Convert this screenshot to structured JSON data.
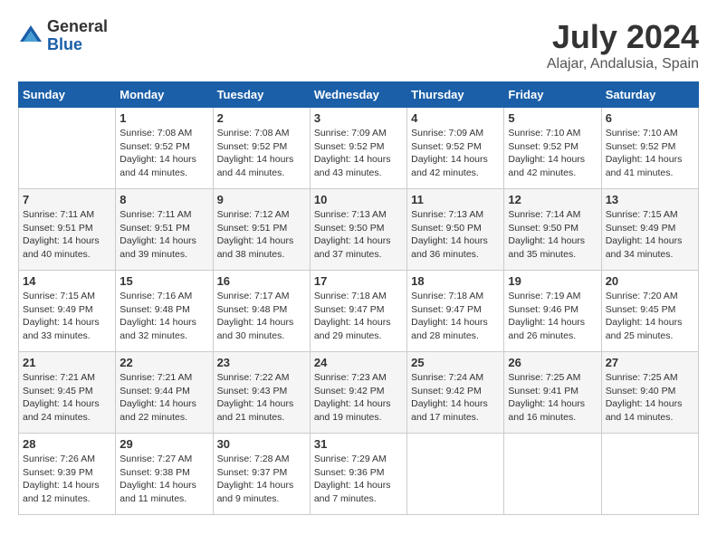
{
  "logo": {
    "general": "General",
    "blue": "Blue"
  },
  "title": {
    "month_year": "July 2024",
    "location": "Alajar, Andalusia, Spain"
  },
  "days_of_week": [
    "Sunday",
    "Monday",
    "Tuesday",
    "Wednesday",
    "Thursday",
    "Friday",
    "Saturday"
  ],
  "weeks": [
    [
      {
        "day": "",
        "info": ""
      },
      {
        "day": "1",
        "info": "Sunrise: 7:08 AM\nSunset: 9:52 PM\nDaylight: 14 hours\nand 44 minutes."
      },
      {
        "day": "2",
        "info": "Sunrise: 7:08 AM\nSunset: 9:52 PM\nDaylight: 14 hours\nand 44 minutes."
      },
      {
        "day": "3",
        "info": "Sunrise: 7:09 AM\nSunset: 9:52 PM\nDaylight: 14 hours\nand 43 minutes."
      },
      {
        "day": "4",
        "info": "Sunrise: 7:09 AM\nSunset: 9:52 PM\nDaylight: 14 hours\nand 42 minutes."
      },
      {
        "day": "5",
        "info": "Sunrise: 7:10 AM\nSunset: 9:52 PM\nDaylight: 14 hours\nand 42 minutes."
      },
      {
        "day": "6",
        "info": "Sunrise: 7:10 AM\nSunset: 9:52 PM\nDaylight: 14 hours\nand 41 minutes."
      }
    ],
    [
      {
        "day": "7",
        "info": "Sunrise: 7:11 AM\nSunset: 9:51 PM\nDaylight: 14 hours\nand 40 minutes."
      },
      {
        "day": "8",
        "info": "Sunrise: 7:11 AM\nSunset: 9:51 PM\nDaylight: 14 hours\nand 39 minutes."
      },
      {
        "day": "9",
        "info": "Sunrise: 7:12 AM\nSunset: 9:51 PM\nDaylight: 14 hours\nand 38 minutes."
      },
      {
        "day": "10",
        "info": "Sunrise: 7:13 AM\nSunset: 9:50 PM\nDaylight: 14 hours\nand 37 minutes."
      },
      {
        "day": "11",
        "info": "Sunrise: 7:13 AM\nSunset: 9:50 PM\nDaylight: 14 hours\nand 36 minutes."
      },
      {
        "day": "12",
        "info": "Sunrise: 7:14 AM\nSunset: 9:50 PM\nDaylight: 14 hours\nand 35 minutes."
      },
      {
        "day": "13",
        "info": "Sunrise: 7:15 AM\nSunset: 9:49 PM\nDaylight: 14 hours\nand 34 minutes."
      }
    ],
    [
      {
        "day": "14",
        "info": "Sunrise: 7:15 AM\nSunset: 9:49 PM\nDaylight: 14 hours\nand 33 minutes."
      },
      {
        "day": "15",
        "info": "Sunrise: 7:16 AM\nSunset: 9:48 PM\nDaylight: 14 hours\nand 32 minutes."
      },
      {
        "day": "16",
        "info": "Sunrise: 7:17 AM\nSunset: 9:48 PM\nDaylight: 14 hours\nand 30 minutes."
      },
      {
        "day": "17",
        "info": "Sunrise: 7:18 AM\nSunset: 9:47 PM\nDaylight: 14 hours\nand 29 minutes."
      },
      {
        "day": "18",
        "info": "Sunrise: 7:18 AM\nSunset: 9:47 PM\nDaylight: 14 hours\nand 28 minutes."
      },
      {
        "day": "19",
        "info": "Sunrise: 7:19 AM\nSunset: 9:46 PM\nDaylight: 14 hours\nand 26 minutes."
      },
      {
        "day": "20",
        "info": "Sunrise: 7:20 AM\nSunset: 9:45 PM\nDaylight: 14 hours\nand 25 minutes."
      }
    ],
    [
      {
        "day": "21",
        "info": "Sunrise: 7:21 AM\nSunset: 9:45 PM\nDaylight: 14 hours\nand 24 minutes."
      },
      {
        "day": "22",
        "info": "Sunrise: 7:21 AM\nSunset: 9:44 PM\nDaylight: 14 hours\nand 22 minutes."
      },
      {
        "day": "23",
        "info": "Sunrise: 7:22 AM\nSunset: 9:43 PM\nDaylight: 14 hours\nand 21 minutes."
      },
      {
        "day": "24",
        "info": "Sunrise: 7:23 AM\nSunset: 9:42 PM\nDaylight: 14 hours\nand 19 minutes."
      },
      {
        "day": "25",
        "info": "Sunrise: 7:24 AM\nSunset: 9:42 PM\nDaylight: 14 hours\nand 17 minutes."
      },
      {
        "day": "26",
        "info": "Sunrise: 7:25 AM\nSunset: 9:41 PM\nDaylight: 14 hours\nand 16 minutes."
      },
      {
        "day": "27",
        "info": "Sunrise: 7:25 AM\nSunset: 9:40 PM\nDaylight: 14 hours\nand 14 minutes."
      }
    ],
    [
      {
        "day": "28",
        "info": "Sunrise: 7:26 AM\nSunset: 9:39 PM\nDaylight: 14 hours\nand 12 minutes."
      },
      {
        "day": "29",
        "info": "Sunrise: 7:27 AM\nSunset: 9:38 PM\nDaylight: 14 hours\nand 11 minutes."
      },
      {
        "day": "30",
        "info": "Sunrise: 7:28 AM\nSunset: 9:37 PM\nDaylight: 14 hours\nand 9 minutes."
      },
      {
        "day": "31",
        "info": "Sunrise: 7:29 AM\nSunset: 9:36 PM\nDaylight: 14 hours\nand 7 minutes."
      },
      {
        "day": "",
        "info": ""
      },
      {
        "day": "",
        "info": ""
      },
      {
        "day": "",
        "info": ""
      }
    ]
  ]
}
